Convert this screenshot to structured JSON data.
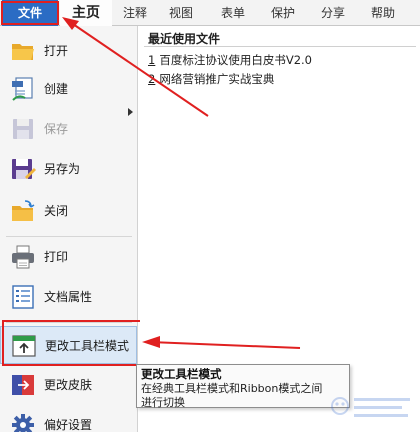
{
  "ribbon": {
    "tabs": [
      {
        "label": "文件",
        "active": true
      },
      {
        "label": "主页"
      },
      {
        "label": "注释"
      },
      {
        "label": "视图"
      },
      {
        "label": "表单"
      },
      {
        "label": "保护"
      },
      {
        "label": "分享"
      },
      {
        "label": "帮助"
      }
    ]
  },
  "menu": {
    "items": [
      {
        "label": "打开",
        "icon": "folder-open-icon"
      },
      {
        "label": "创建",
        "icon": "create-pdf-icon",
        "has_submenu": true
      },
      {
        "label": "保存",
        "icon": "save-icon",
        "disabled": true
      },
      {
        "label": "另存为",
        "icon": "save-as-icon"
      },
      {
        "label": "关闭",
        "icon": "close-folder-icon"
      },
      {
        "label": "打印",
        "icon": "printer-icon"
      },
      {
        "label": "文档属性",
        "icon": "document-properties-icon"
      },
      {
        "label": "更改工具栏模式",
        "icon": "toolbar-mode-icon",
        "selected": true
      },
      {
        "label": "更改皮肤",
        "icon": "skin-icon"
      },
      {
        "label": "偏好设置",
        "icon": "gear-icon"
      }
    ]
  },
  "recent": {
    "title": "最近使用文件",
    "files": [
      {
        "num": "1",
        "name": "百度标注协议使用白皮书V2.0"
      },
      {
        "num": "2",
        "name": "网络营销推广实战宝典"
      }
    ]
  },
  "tooltip": {
    "title": "更改工具栏模式",
    "desc_line1": "在经典工具栏模式和Ribbon模式之间",
    "desc_line2": "进行切换"
  },
  "colors": {
    "file_tab": "#2b6cc4",
    "annotation_red": "#e02020",
    "selected_bg": "#dce9f7"
  }
}
